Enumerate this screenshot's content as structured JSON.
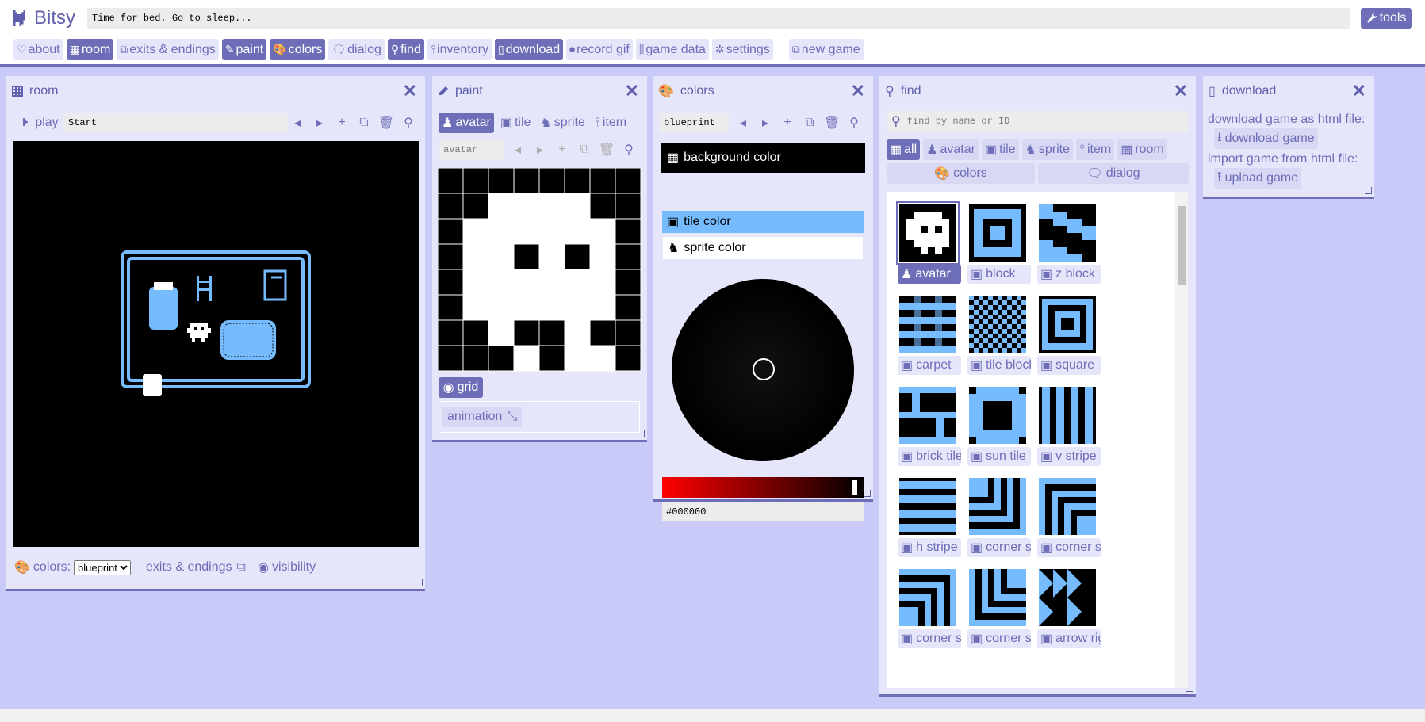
{
  "app": {
    "name": "Bitsy",
    "game_title": "Time for bed. Go to sleep...",
    "tools_label": "tools"
  },
  "nav": [
    "about",
    "room",
    "exits & endings",
    "paint",
    "colors",
    "dialog",
    "find",
    "inventory",
    "download",
    "record gif",
    "game data",
    "settings",
    "new game"
  ],
  "nav_active": [
    "room",
    "paint",
    "colors",
    "find",
    "download"
  ],
  "room": {
    "title": "room",
    "play": "play",
    "room_name": "Start",
    "colors_label": "colors:",
    "palette_selected": "blueprint",
    "exits_label": "exits & endings",
    "visibility_label": "visibility"
  },
  "paint": {
    "title": "paint",
    "tabs": [
      "avatar",
      "tile",
      "sprite",
      "item"
    ],
    "name": "avatar",
    "grid_label": "grid",
    "animation_label": "animation"
  },
  "colors": {
    "title": "colors",
    "palette_name": "blueprint",
    "items": [
      "background color",
      "tile color",
      "sprite color"
    ],
    "hex": "#000000"
  },
  "find": {
    "title": "find",
    "placeholder": "find by name or ID",
    "filters": [
      "all",
      "avatar",
      "tile",
      "sprite",
      "item",
      "room"
    ],
    "filters2": [
      "colors",
      "dialog"
    ],
    "items": [
      "avatar",
      "block",
      "z block",
      "carpet",
      "tile block",
      "square",
      "brick tile",
      "sun tile",
      "v stripe",
      "h stripe",
      "corner stripe",
      "corner stripe",
      "corner stripe",
      "corner stripe",
      "arrow right"
    ]
  },
  "download": {
    "title": "download",
    "export_label": "download game as html file:",
    "download_btn": "download game",
    "import_label": "import game from html file:",
    "upload_btn": "upload game"
  },
  "colors_palette": {
    "background": "#000000",
    "tile": "#75bbfd",
    "sprite": "#ffffff",
    "accent": "#6d6db8"
  }
}
